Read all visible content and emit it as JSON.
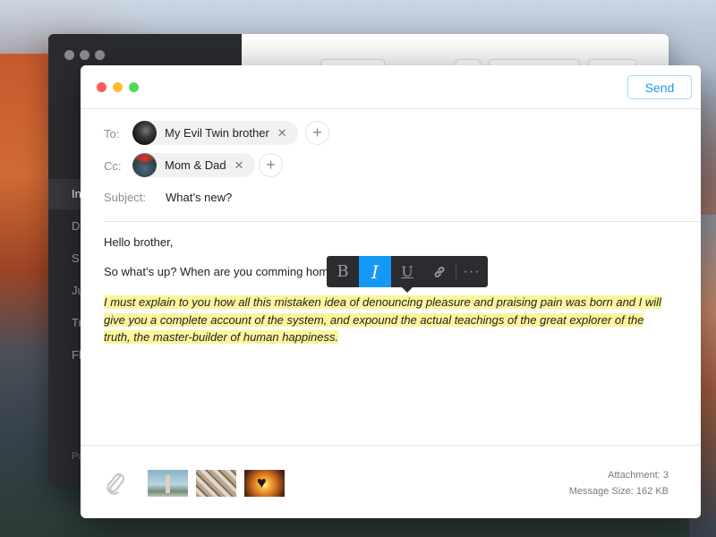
{
  "background_window": {
    "sidebar_items": [
      {
        "label": "In",
        "active": true
      },
      {
        "label": "D",
        "active": false
      },
      {
        "label": "S",
        "active": false
      },
      {
        "label": "Ju",
        "active": false
      },
      {
        "label": "Tr",
        "active": false
      },
      {
        "label": "Fl",
        "active": false
      }
    ],
    "sidebar_footer": "Pa"
  },
  "compose": {
    "send_label": "Send",
    "to_label": "To:",
    "cc_label": "Cc:",
    "subject_label": "Subject:",
    "to_recipients": [
      {
        "name": "My Evil Twin brother",
        "remove": "✕"
      }
    ],
    "cc_recipients": [
      {
        "name": "Mom & Dad",
        "remove": "✕"
      }
    ],
    "add_icon": "+",
    "subject": "What’s new?",
    "body": {
      "greeting": "Hello brother,",
      "line2": "So what’s up? When are you comming home?",
      "highlighted": "I must explain to you how all this mistaken idea of denouncing pleasure and praising pain was born and I will give you a complete account of the system, and expound the actual teachings of the great explorer of the truth, the master-builder of human happiness."
    },
    "format_toolbar": {
      "bold": "B",
      "italic": "I",
      "underline": "U",
      "link": "link-icon",
      "more": "···",
      "active": "italic"
    },
    "footer": {
      "attachment_count": "Attachment: 3",
      "message_size": "Message Size: 162 KB",
      "attachments": [
        {
          "name": "statue-of-liberty-thumbnail"
        },
        {
          "name": "city-street-thumbnail"
        },
        {
          "name": "heart-sunset-thumbnail"
        }
      ]
    }
  },
  "colors": {
    "accent": "#1499f7",
    "send_text": "#1e97e8",
    "highlight": "#fdf49c",
    "traffic_close": "#fc5b57",
    "traffic_min": "#fdbb2e",
    "traffic_max": "#52d95a"
  }
}
